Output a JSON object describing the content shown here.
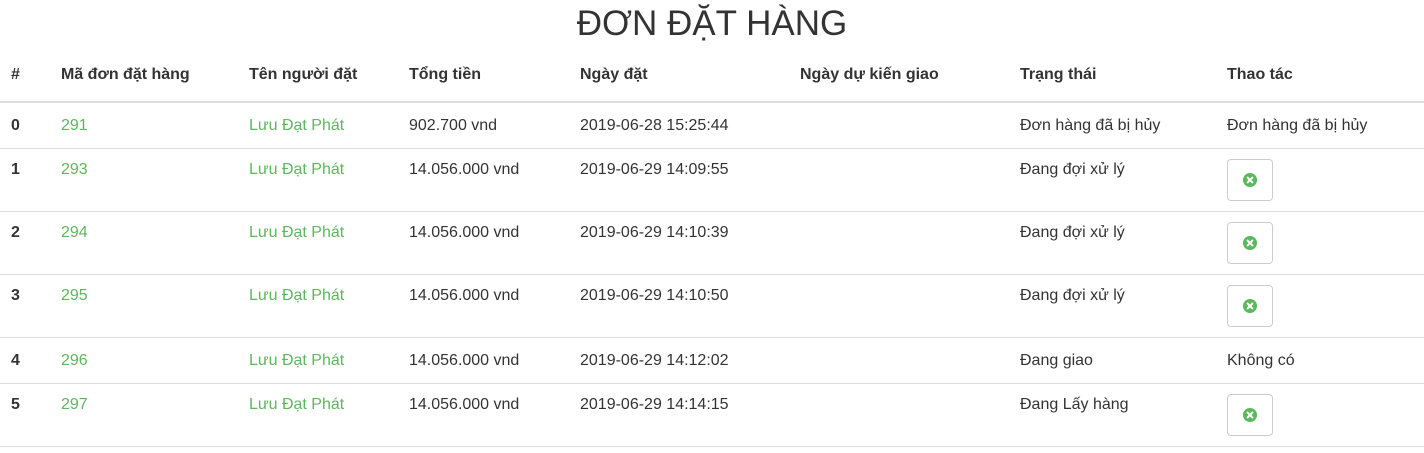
{
  "page": {
    "title": "ĐƠN ĐẶT HÀNG"
  },
  "table": {
    "headers": [
      "#",
      "Mã đơn đặt hàng",
      "Tên người đặt",
      "Tổng tiền",
      "Ngày đặt",
      "Ngày dự kiến giao",
      "Trạng thái",
      "Thao tác"
    ],
    "rows": [
      {
        "index": "0",
        "order_id": "291",
        "customer": "Lưu Đạt Phát",
        "total": "902.700 vnd",
        "order_date": "2019-06-28 15:25:44",
        "expected_delivery": "",
        "status": "Đơn hàng đã bị hủy",
        "action_text": "Đơn hàng đã bị hủy"
      },
      {
        "index": "1",
        "order_id": "293",
        "customer": "Lưu Đạt Phát",
        "total": "14.056.000 vnd",
        "order_date": "2019-06-29 14:09:55",
        "expected_delivery": "",
        "status": "Đang đợi xử lý",
        "action": "cancel-icon"
      },
      {
        "index": "2",
        "order_id": "294",
        "customer": "Lưu Đạt Phát",
        "total": "14.056.000 vnd",
        "order_date": "2019-06-29 14:10:39",
        "expected_delivery": "",
        "status": "Đang đợi xử lý",
        "action": "cancel-icon"
      },
      {
        "index": "3",
        "order_id": "295",
        "customer": "Lưu Đạt Phát",
        "total": "14.056.000 vnd",
        "order_date": "2019-06-29 14:10:50",
        "expected_delivery": "",
        "status": "Đang đợi xử lý",
        "action": "cancel-icon"
      },
      {
        "index": "4",
        "order_id": "296",
        "customer": "Lưu Đạt Phát",
        "total": "14.056.000 vnd",
        "order_date": "2019-06-29 14:12:02",
        "expected_delivery": "",
        "status": "Đang giao",
        "action_text": "Không có"
      },
      {
        "index": "5",
        "order_id": "297",
        "customer": "Lưu Đạt Phát",
        "total": "14.056.000 vnd",
        "order_date": "2019-06-29 14:14:15",
        "expected_delivery": "",
        "status": "Đang Lấy hàng",
        "action": "cancel-icon"
      }
    ]
  },
  "colors": {
    "link": "#5cb85c",
    "cancel_icon": "#5cb85c",
    "border": "#dddddd"
  }
}
